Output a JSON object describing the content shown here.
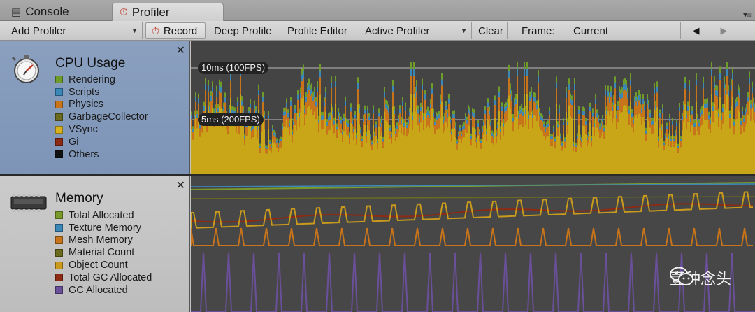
{
  "tabs": [
    {
      "label": "Console",
      "icon": "console-icon"
    },
    {
      "label": "Profiler",
      "icon": "stopwatch-icon"
    }
  ],
  "toolbar": {
    "add_profiler": "Add Profiler",
    "record": "Record",
    "deep_profile": "Deep Profile",
    "profile_editor": "Profile Editor",
    "active_profiler": "Active Profiler",
    "clear": "Clear",
    "frame_label": "Frame:",
    "frame_value": "Current",
    "prev_icon": "triangle-left-icon",
    "next_icon": "triangle-right-icon"
  },
  "cpu": {
    "title": "CPU Usage",
    "icon": "stopwatch-icon",
    "legend": [
      {
        "label": "Rendering",
        "color": "#6f9b2a"
      },
      {
        "label": "Scripts",
        "color": "#3a87b8"
      },
      {
        "label": "Physics",
        "color": "#c8741b"
      },
      {
        "label": "GarbageCollector",
        "color": "#6b6b1f"
      },
      {
        "label": "VSync",
        "color": "#d7b21e"
      },
      {
        "label": "Gi",
        "color": "#8c2a14"
      },
      {
        "label": "Others",
        "color": "#111111"
      }
    ],
    "fps_10": "10ms (100FPS)",
    "fps_5": "5ms (200FPS)"
  },
  "memory": {
    "title": "Memory",
    "icon": "memory-chip-icon",
    "legend": [
      {
        "label": "Total Allocated",
        "color": "#7a9a2a"
      },
      {
        "label": "Texture Memory",
        "color": "#3a87b8"
      },
      {
        "label": "Mesh Memory",
        "color": "#c8741b"
      },
      {
        "label": "Material Count",
        "color": "#6b6b1f"
      },
      {
        "label": "Object Count",
        "color": "#c99a1c"
      },
      {
        "label": "Total GC Allocated",
        "color": "#8c2a14"
      },
      {
        "label": "GC Allocated",
        "color": "#6a4f9a"
      }
    ]
  },
  "watermark": {
    "text": "壹种念头",
    "icon": "wechat-icon"
  }
}
